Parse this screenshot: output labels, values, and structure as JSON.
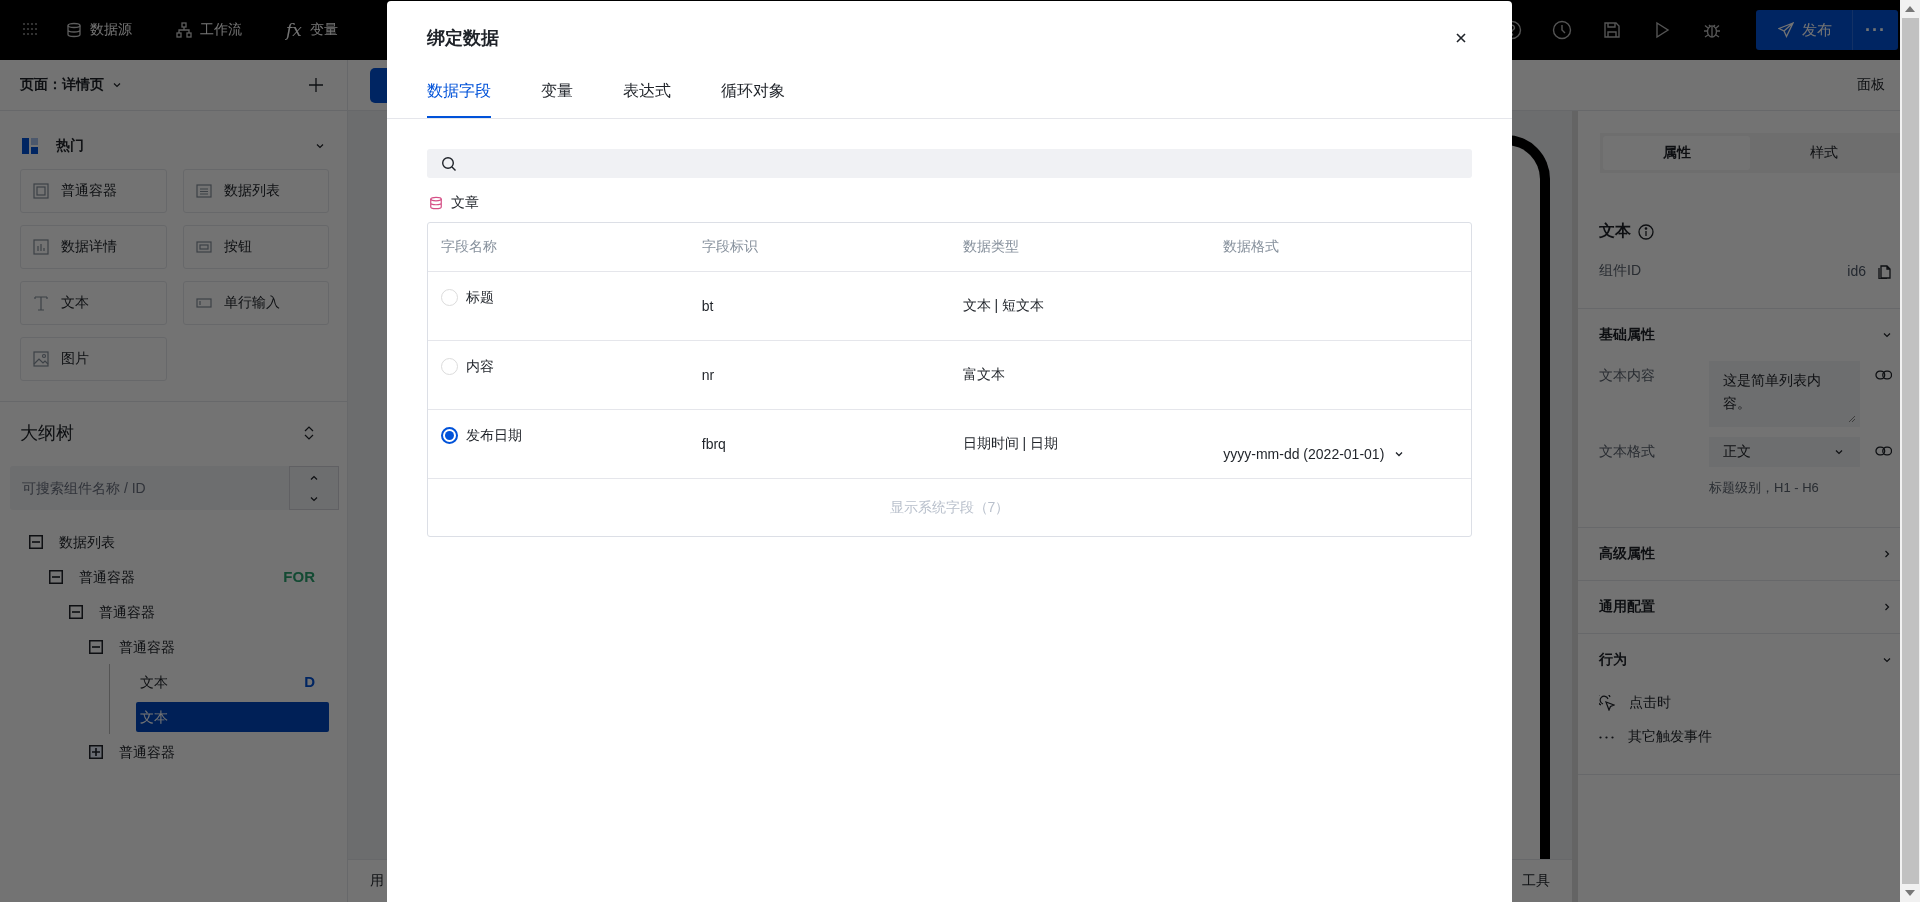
{
  "top_bar": {
    "nav": [
      {
        "label": "数据源"
      },
      {
        "label": "工作流"
      },
      {
        "label": "变量",
        "icon_text": "fx"
      }
    ],
    "publish_button": "发布",
    "more_button": "···"
  },
  "left_panel": {
    "page_selector": "页面：详情页",
    "category": {
      "title": "热门",
      "expanded": true
    },
    "components": [
      {
        "label": "普通容器"
      },
      {
        "label": "数据列表"
      },
      {
        "label": "数据详情"
      },
      {
        "label": "按钮"
      },
      {
        "label": "文本"
      },
      {
        "label": "单行输入"
      },
      {
        "label": "图片"
      }
    ],
    "outline": {
      "title": "大纲树",
      "search_placeholder": "可搜索组件名称 / ID",
      "tree": [
        {
          "label": "数据列表",
          "expanded": true,
          "selected": false,
          "children": [
            {
              "label": "普通容器",
              "expanded": true,
              "selected": false,
              "badge": {
                "text": "FOR",
                "kind": "loop"
              },
              "children": [
                {
                  "label": "普通容器",
                  "expanded": true,
                  "selected": false,
                  "children": [
                    {
                      "label": "普通容器",
                      "expanded": true,
                      "selected": false,
                      "children": [
                        {
                          "label": "文本",
                          "selected": false,
                          "badge": {
                            "text": "D",
                            "kind": "data"
                          }
                        },
                        {
                          "label": "文本",
                          "selected": true
                        }
                      ]
                    },
                    {
                      "label": "普通容器",
                      "expanded": false,
                      "selected": false
                    }
                  ]
                }
              ]
            }
          ]
        }
      ]
    }
  },
  "canvas": {
    "header": "面板",
    "bottom_left": "用",
    "bottom_right": "工具"
  },
  "right_panel": {
    "tabs": [
      {
        "label": "属性",
        "selected": true
      },
      {
        "label": "样式",
        "selected": false
      }
    ],
    "component": {
      "title": "文本",
      "id_label": "组件ID",
      "id_value": "id6"
    },
    "sections": [
      {
        "title": "基础属性",
        "expanded": true,
        "fields": [
          {
            "kind": "textarea",
            "label": "文本内容",
            "value": "这是简单列表内容。"
          },
          {
            "kind": "select",
            "label": "文本格式",
            "value": "正文",
            "hint": "标题级别，H1 - H6"
          }
        ]
      },
      {
        "title": "高级属性",
        "expanded": false
      },
      {
        "title": "通用配置",
        "expanded": false
      },
      {
        "title": "行为",
        "expanded": true,
        "events": [
          {
            "label": "点击时"
          },
          {
            "label": "其它触发事件"
          }
        ]
      }
    ]
  },
  "modal": {
    "title": "绑定数据",
    "tabs": [
      {
        "label": "数据字段",
        "selected": true
      },
      {
        "label": "变量",
        "selected": false
      },
      {
        "label": "表达式",
        "selected": false
      },
      {
        "label": "循环对象",
        "selected": false
      }
    ],
    "source": "文章",
    "table": {
      "columns": [
        "字段名称",
        "字段标识",
        "数据类型",
        "数据格式"
      ],
      "rows": [
        {
          "name": "标题",
          "id": "bt",
          "type": "文本 | 短文本",
          "selected": false
        },
        {
          "name": "内容",
          "id": "nr",
          "type": "富文本",
          "selected": false
        },
        {
          "name": "发布日期",
          "id": "fbrq",
          "type": "日期时间 | 日期",
          "format": "yyyy-mm-dd (2022-01-01)",
          "selected": true
        }
      ],
      "footer": "显示系统字段（7）"
    }
  }
}
